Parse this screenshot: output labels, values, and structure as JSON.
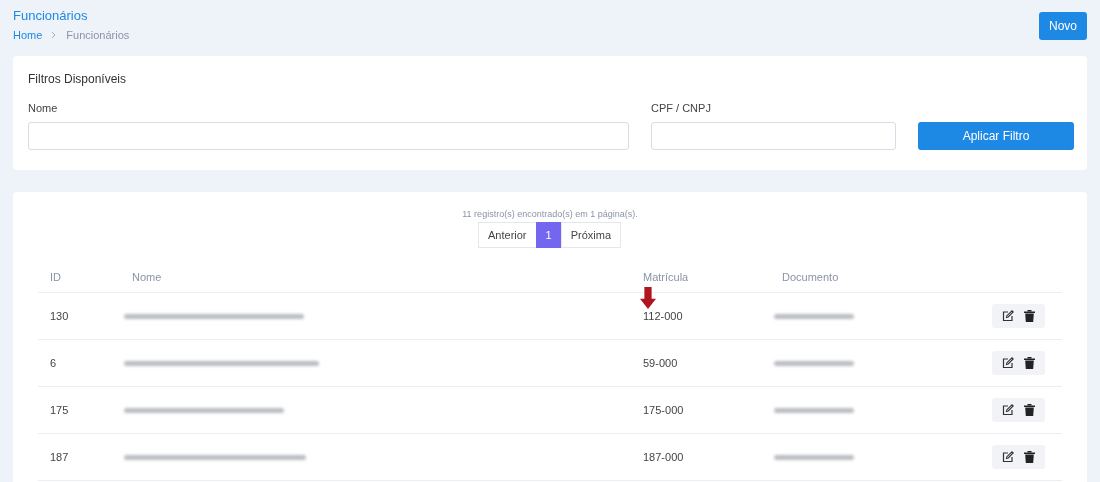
{
  "header": {
    "title": "Funcionários",
    "breadcrumb": [
      {
        "label": "Home",
        "link": true
      },
      {
        "label": "Funcionários",
        "link": false
      }
    ],
    "new_button": "Novo"
  },
  "filters": {
    "title": "Filtros Disponíveis",
    "fields": [
      {
        "label": "Nome"
      },
      {
        "label": "CPF / CNPJ"
      }
    ],
    "apply_button": "Aplicar Filtro"
  },
  "results": {
    "summary": "11 registro(s) encontrado(s) em 1 página(s).",
    "pagination": [
      {
        "label": "Anterior",
        "selected": false
      },
      {
        "label": "1",
        "selected": true
      },
      {
        "label": "Próxima",
        "selected": false
      }
    ],
    "columns": [
      "ID",
      "Nome",
      "Matrícula",
      "Documento"
    ],
    "rows": [
      {
        "id": "130",
        "name_redacted": true,
        "matricula": "112-000",
        "document_redacted": true
      },
      {
        "id": "6",
        "name_redacted": true,
        "matricula": "59-000",
        "document_redacted": true
      },
      {
        "id": "175",
        "name_redacted": true,
        "matricula": "175-000",
        "document_redacted": true
      },
      {
        "id": "187",
        "name_redacted": true,
        "matricula": "187-000",
        "document_redacted": true
      }
    ]
  }
}
